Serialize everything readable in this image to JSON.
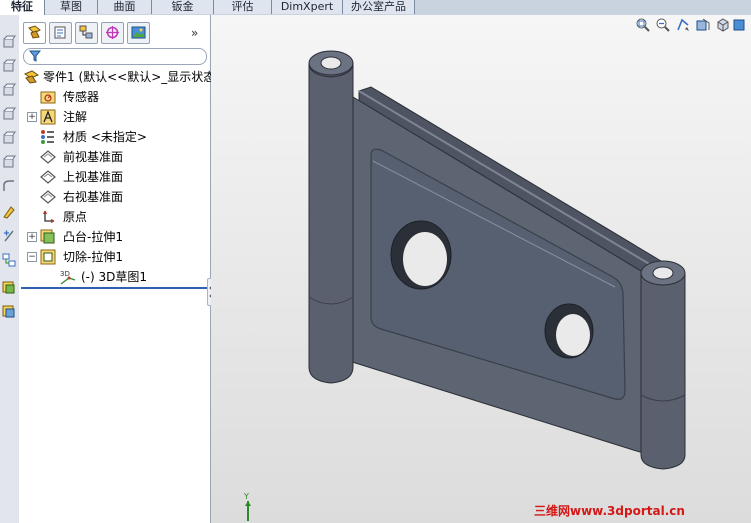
{
  "tabs": [
    {
      "label": "特征",
      "active": true
    },
    {
      "label": "草图"
    },
    {
      "label": "曲面"
    },
    {
      "label": "钣金"
    },
    {
      "label": "评估"
    },
    {
      "label": "DimXpert"
    },
    {
      "label": "办公室产品"
    }
  ],
  "feature_tree": {
    "root": {
      "label": "零件1 (默认<<默认>_显示状态",
      "icon": "part-icon"
    },
    "items": [
      {
        "label": "传感器",
        "icon": "sensor-folder-icon",
        "expander": ""
      },
      {
        "label": "注解",
        "icon": "annotation-icon",
        "expander": "+"
      },
      {
        "label": "材质 <未指定>",
        "icon": "material-icon",
        "expander": ""
      },
      {
        "label": "前视基准面",
        "icon": "plane-icon",
        "expander": ""
      },
      {
        "label": "上视基准面",
        "icon": "plane-icon",
        "expander": ""
      },
      {
        "label": "右视基准面",
        "icon": "plane-icon",
        "expander": ""
      },
      {
        "label": "原点",
        "icon": "origin-icon",
        "expander": ""
      },
      {
        "label": "凸台-拉伸1",
        "icon": "boss-extrude-icon",
        "expander": "+"
      },
      {
        "label": "切除-拉伸1",
        "icon": "cut-extrude-icon",
        "expander": "−"
      }
    ],
    "sub_items": [
      {
        "label": "(-) 3D草图1",
        "icon": "3d-sketch-icon",
        "icon_text": "3D"
      }
    ],
    "more_label": "»"
  },
  "view": {
    "triad_label": "Y",
    "watermark": "三维网www.3dportal.cn"
  },
  "colors": {
    "tab_bar": "#c9d3e0",
    "panel_bg": "#ffffff",
    "model_face": "#5d6472",
    "model_edge": "#2a2e36",
    "watermark": "#d41717",
    "rollback_bar": "#2f5fb0"
  }
}
